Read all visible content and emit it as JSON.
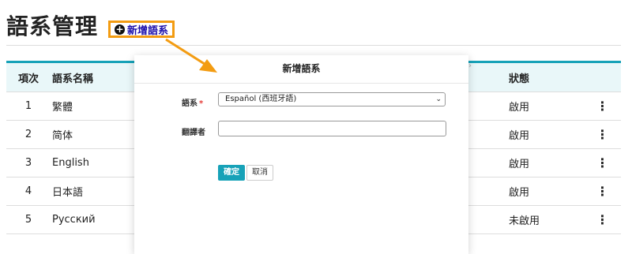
{
  "page": {
    "title": "語系管理",
    "add_button_label": "新增語系"
  },
  "table": {
    "headers": {
      "index": "項次",
      "name": "語系名稱",
      "status": "狀態"
    },
    "rows": [
      {
        "index": "1",
        "name": "繁體",
        "status": "啟用"
      },
      {
        "index": "2",
        "name": "简体",
        "status": "啟用"
      },
      {
        "index": "3",
        "name": "English",
        "status": "啟用"
      },
      {
        "index": "4",
        "name": "日本語",
        "status": "啟用"
      },
      {
        "index": "5",
        "name": "Русский",
        "status": "未啟用"
      }
    ],
    "row_menu_icon": "kebab-menu-icon"
  },
  "modal": {
    "title": "新增語系",
    "language_label": "語系",
    "required_mark": "*",
    "language_value": "Español (西班牙語)",
    "translator_label": "翻譯者",
    "translator_value": "",
    "confirm_label": "確定",
    "cancel_label": "取消"
  },
  "colors": {
    "accent": "#17a2b8",
    "highlight": "#f39c12",
    "link": "#1a0dab",
    "required": "#e53935"
  }
}
